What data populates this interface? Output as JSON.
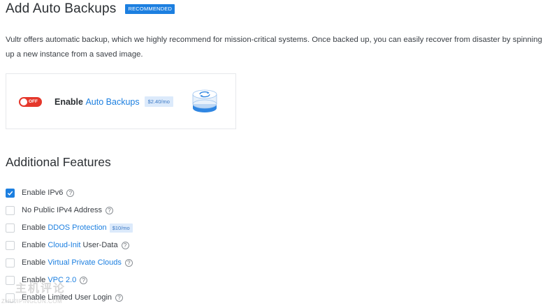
{
  "header": {
    "title": "Add Auto Backups",
    "badge": "RECOMMENDED"
  },
  "description": "Vultr offers automatic backup, which we highly recommend for mission-critical systems. Once backed up, you can easily recover from disaster by spinning up a new instance from a saved image.",
  "backup_card": {
    "toggle_label": "OFF",
    "toggle_on": false,
    "enable_prefix": "Enable ",
    "enable_link": "Auto Backups",
    "price": "$2.40/mo"
  },
  "additional": {
    "title": "Additional Features",
    "features": [
      {
        "prefix": "Enable IPv6",
        "link": "",
        "suffix": "",
        "price": "",
        "help": true,
        "checked": true
      },
      {
        "prefix": "No Public IPv4 Address",
        "link": "",
        "suffix": "",
        "price": "",
        "help": true,
        "checked": false
      },
      {
        "prefix": "Enable ",
        "link": "DDOS Protection",
        "suffix": "",
        "price": "$10/mo",
        "help": false,
        "checked": false
      },
      {
        "prefix": "Enable ",
        "link": "Cloud-Init",
        "suffix": " User-Data",
        "price": "",
        "help": true,
        "checked": false
      },
      {
        "prefix": "Enable ",
        "link": "Virtual Private Clouds",
        "suffix": "",
        "price": "",
        "help": true,
        "checked": false
      },
      {
        "prefix": "Enable ",
        "link": "VPC 2.0",
        "suffix": "",
        "price": "",
        "help": true,
        "checked": false
      },
      {
        "prefix": "Enable Limited User Login",
        "link": "",
        "suffix": "",
        "price": "",
        "help": true,
        "checked": false
      }
    ]
  },
  "icons": {
    "help": "help-circle-icon",
    "check": "check-icon",
    "disk": "backup-disk-icon"
  },
  "colors": {
    "accent": "#1c7fe0",
    "toggle_off": "#e5372b",
    "price_bg": "#dceafb"
  },
  "watermark": {
    "text": "主机评论",
    "sub": "ZHUJIPINGLUN.COM"
  }
}
